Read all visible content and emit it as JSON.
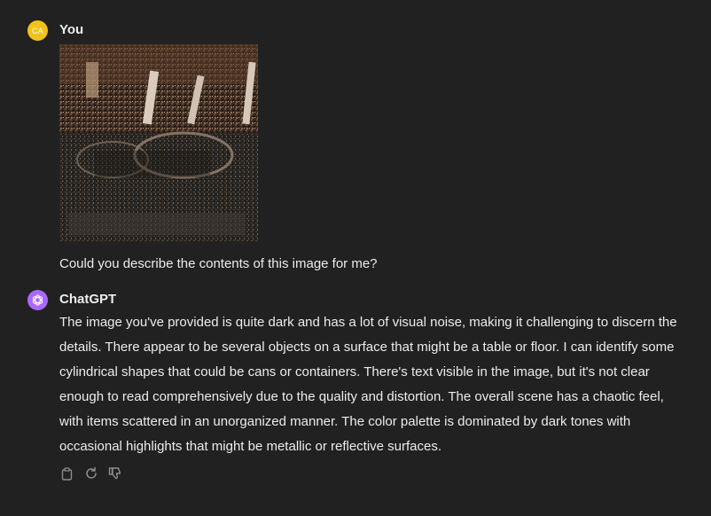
{
  "user": {
    "avatar_initials": "CA",
    "name": "You",
    "avatar_color": "#f2c21a",
    "message": "Could you describe the contents of this image for me?",
    "attachment_icon": "noisy-photo"
  },
  "assistant": {
    "name": "ChatGPT",
    "avatar_color": "#ab68ff",
    "avatar_icon": "openai-logo-icon",
    "message": "The image you've provided is quite dark and has a lot of visual noise, making it challenging to discern the details. There appear to be several objects on a surface that might be a table or floor. I can identify some cylindrical shapes that could be cans or containers. There's text visible in the image, but it's not clear enough to read comprehensively due to the quality and distortion. The overall scene has a chaotic feel, with items scattered in an unorganized manner. The color palette is dominated by dark tones with occasional highlights that might be metallic or reflective surfaces."
  },
  "actions": [
    {
      "icon": "copy-icon"
    },
    {
      "icon": "regenerate-icon"
    },
    {
      "icon": "thumbs-down-icon"
    }
  ],
  "theme": {
    "background": "#212121",
    "text": "#ececec",
    "muted_icon": "#8e8e8e"
  }
}
